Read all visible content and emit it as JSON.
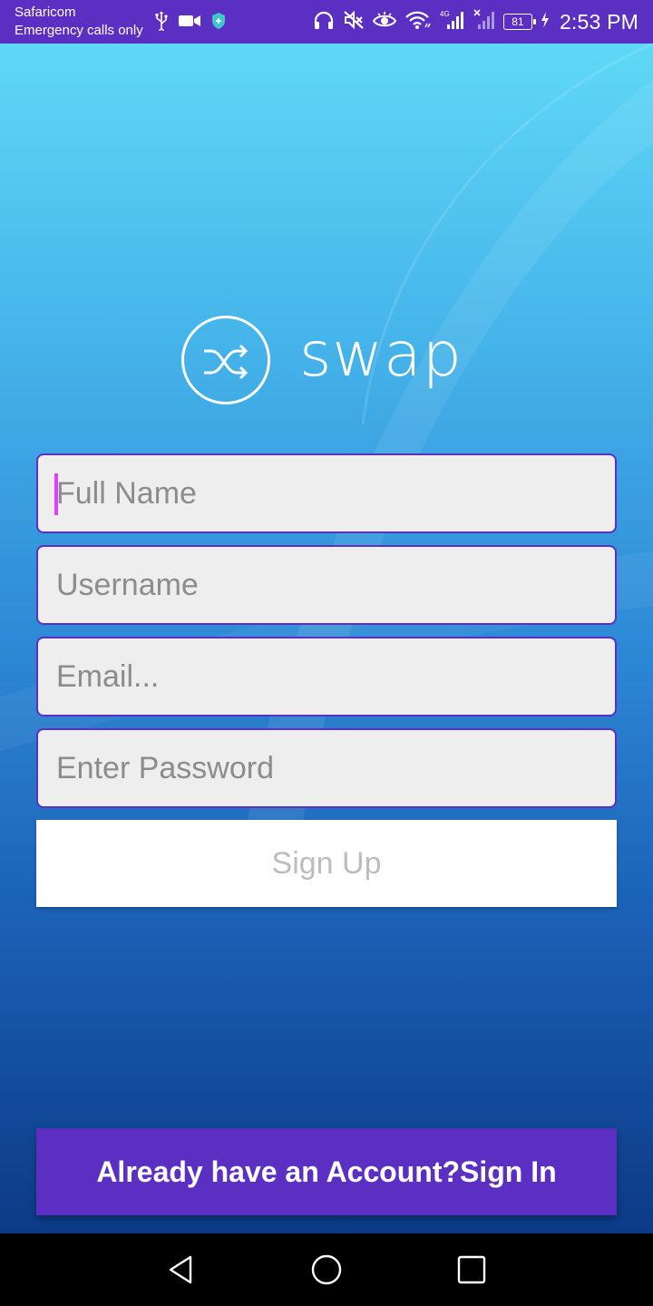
{
  "status_bar": {
    "carrier": "Safaricom",
    "carrier_status": "Emergency calls only",
    "network": "4G",
    "battery": "81",
    "time": "2:53 PM",
    "left_icons": [
      "usb-icon",
      "video-icon",
      "shield-icon"
    ],
    "right_icons": [
      "headphones-icon",
      "mute-icon",
      "eye-icon",
      "wifi-icon",
      "signal-icon",
      "signal-off-icon",
      "battery-icon",
      "charging-icon"
    ]
  },
  "app": {
    "logo_text": "swap",
    "colors": {
      "accent": "#5a2fc2",
      "caret": "#e040fb",
      "field_bg": "#eeeeee",
      "gradient_top": "#5fd8f6",
      "gradient_bottom": "#0c3a86"
    }
  },
  "form": {
    "full_name_placeholder": "Full Name",
    "username_placeholder": "Username",
    "email_placeholder": "Email...",
    "password_placeholder": "Enter Password",
    "signup_label": "Sign Up"
  },
  "footer": {
    "signin_label": "Already have an Account?Sign In"
  },
  "nav": {
    "icons": [
      "back-icon",
      "home-icon",
      "recents-icon"
    ]
  }
}
